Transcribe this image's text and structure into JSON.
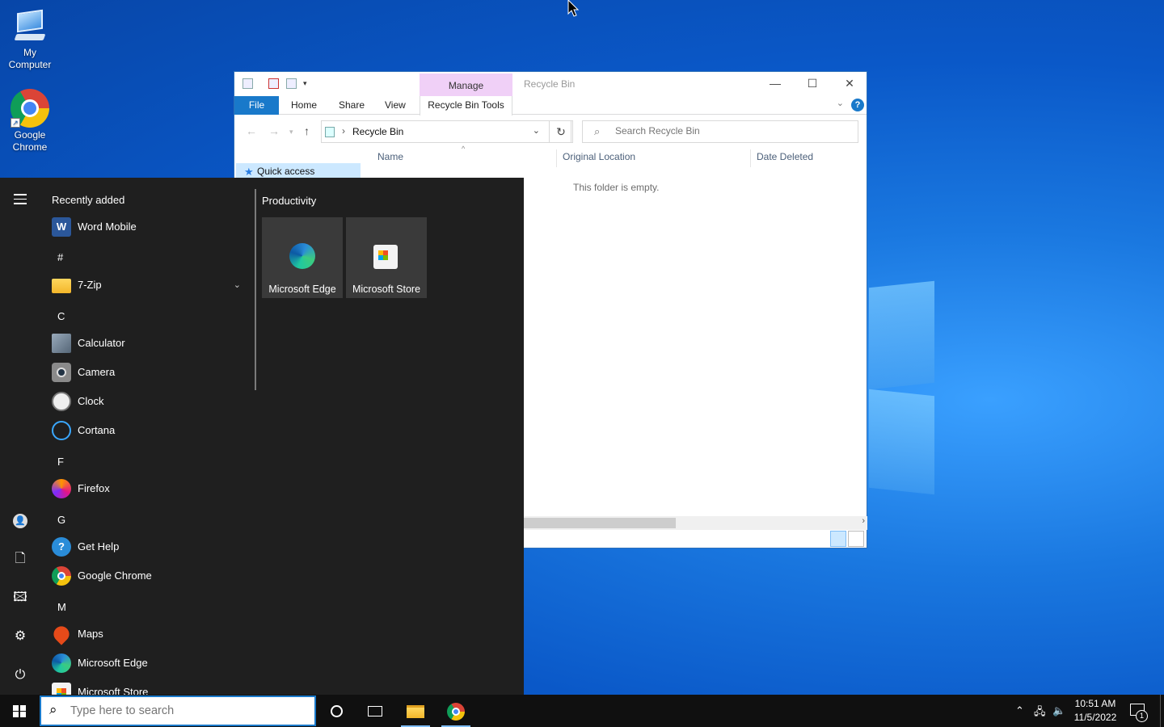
{
  "desktop": {
    "icons": [
      {
        "label": "My Computer"
      },
      {
        "label": "Google Chrome"
      }
    ]
  },
  "explorer": {
    "title": "Recycle Bin",
    "manage_tab": "Manage",
    "ribbon_tabs": [
      "File",
      "Home",
      "Share",
      "View",
      "Recycle Bin Tools"
    ],
    "address": "Recycle Bin",
    "search_placeholder": "Search Recycle Bin",
    "nav_quick_access": "Quick access",
    "columns": [
      "Name",
      "Original Location",
      "Date Deleted"
    ],
    "empty_message": "This folder is empty."
  },
  "start_menu": {
    "recently_added": "Recently added",
    "productivity": "Productivity",
    "apps": {
      "word": "Word Mobile",
      "hash": "#",
      "zip": "7-Zip",
      "c": "C",
      "calculator": "Calculator",
      "camera": "Camera",
      "clock": "Clock",
      "cortana": "Cortana",
      "f": "F",
      "firefox": "Firefox",
      "g": "G",
      "gethelp": "Get Help",
      "chrome": "Google Chrome",
      "m": "M",
      "maps": "Maps",
      "edge": "Microsoft Edge",
      "store": "Microsoft Store"
    },
    "tiles": [
      "Microsoft Edge",
      "Microsoft Store"
    ]
  },
  "taskbar": {
    "search_placeholder": "Type here to search",
    "time": "10:51 AM",
    "date": "11/5/2022",
    "notification_count": "1"
  },
  "colors": {
    "accent": "#1979ca",
    "start_bg": "#1f1f1f",
    "taskbar_bg": "#101010",
    "manage_tab": "#f0d0f7"
  }
}
